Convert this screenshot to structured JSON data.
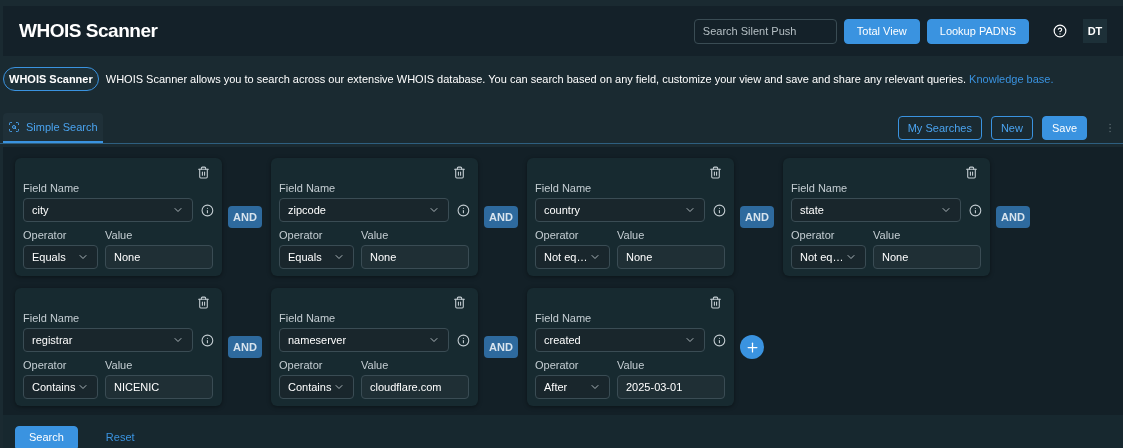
{
  "header": {
    "title": "WHOIS Scanner",
    "search": {
      "placeholder": "Search Silent Push"
    },
    "buttons": [
      {
        "label": "Total View",
        "kind": "filled"
      },
      {
        "label": "Lookup PADNS",
        "kind": "filled"
      }
    ],
    "avatar": "DT"
  },
  "intro": {
    "badge": "WHOIS Scanner",
    "text": "WHOIS Scanner allows you to search across our extensive WHOIS database. You can search based on any field, customize your view and save and share any relevant queries.",
    "link": "Knowledge base."
  },
  "tabs": [
    {
      "label": "Simple Search",
      "selected": true
    }
  ],
  "actions": [
    {
      "label": "My Searches",
      "kind": "outline"
    },
    {
      "label": "New",
      "kind": "outline"
    },
    {
      "label": "Save",
      "kind": "filled"
    }
  ],
  "rows": [
    {
      "conditions": [
        {
          "field_label": "Field Name",
          "field": "city",
          "operator_label": "Operator",
          "operator": "Equals",
          "value_label": "Value",
          "value": "None",
          "connector": "AND"
        },
        {
          "field_label": "Field Name",
          "field": "zipcode",
          "operator_label": "Operator",
          "operator": "Equals",
          "value_label": "Value",
          "value": "None",
          "connector": "AND"
        },
        {
          "field_label": "Field Name",
          "field": "country",
          "operator_label": "Operator",
          "operator": "Not eq…",
          "value_label": "Value",
          "value": "None",
          "connector": "AND"
        },
        {
          "field_label": "Field Name",
          "field": "state",
          "operator_label": "Operator",
          "operator": "Not eq…",
          "value_label": "Value",
          "value": "None",
          "connector": "AND"
        }
      ]
    },
    {
      "conditions": [
        {
          "field_label": "Field Name",
          "field": "registrar",
          "operator_label": "Operator",
          "operator": "Contains",
          "value_label": "Value",
          "value": "NICENIC",
          "connector": "AND"
        },
        {
          "field_label": "Field Name",
          "field": "nameserver",
          "operator_label": "Operator",
          "operator": "Contains",
          "value_label": "Value",
          "value": "cloudflare.com",
          "connector": "AND"
        },
        {
          "field_label": "Field Name",
          "field": "created",
          "operator_label": "Operator",
          "operator": "After",
          "value_label": "Value",
          "value": "2025-03-01"
        }
      ],
      "add_button": true
    }
  ],
  "footer": [
    {
      "label": "Search",
      "kind": "filled"
    },
    {
      "label": "Reset",
      "kind": "link"
    }
  ]
}
